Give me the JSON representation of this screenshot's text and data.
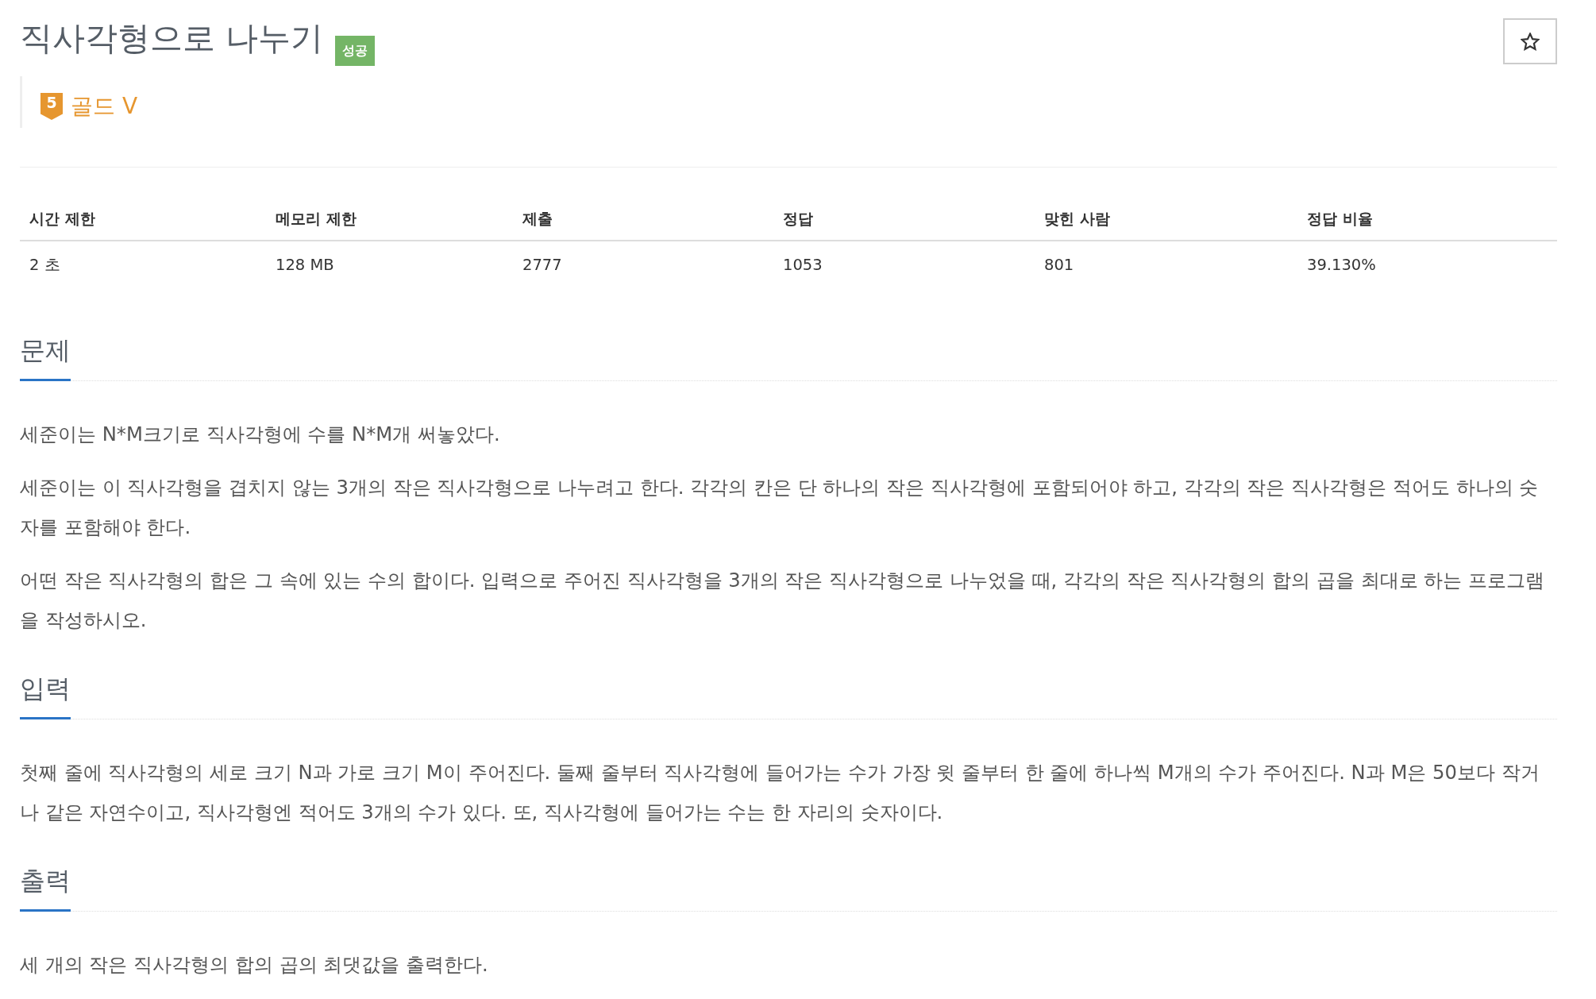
{
  "problem": {
    "title": "직사각형으로 나누기",
    "result": {
      "label": "성공",
      "kind": "success"
    },
    "tier": {
      "number": "5",
      "label": "골드 V"
    }
  },
  "favorite": {
    "starred": false
  },
  "table": {
    "columns": [
      "시간 제한",
      "메모리 제한",
      "제출",
      "정답",
      "맞힌 사람",
      "정답 비율"
    ],
    "rows": [
      [
        "2 초",
        "128 MB",
        "2777",
        "1053",
        "801",
        "39.130%"
      ]
    ]
  },
  "sections": [
    {
      "heading": "문제",
      "paragraphs": [
        "세준이는 N*M크기로 직사각형에 수를 N*M개 써놓았다.",
        "세준이는 이 직사각형을 겹치지 않는 3개의 작은 직사각형으로 나누려고 한다. 각각의 칸은 단 하나의 작은 직사각형에 포함되어야 하고, 각각의 작은 직사각형은 적어도 하나의 숫자를 포함해야 한다.",
        "어떤 작은 직사각형의 합은 그 속에 있는 수의 합이다. 입력으로 주어진 직사각형을 3개의 작은 직사각형으로 나누었을 때, 각각의 작은 직사각형의 합의 곱을 최대로 하는 프로그램을 작성하시오."
      ]
    },
    {
      "heading": "입력",
      "paragraphs": [
        "첫째 줄에 직사각형의 세로 크기 N과 가로 크기 M이 주어진다. 둘째 줄부터 직사각형에 들어가는 수가 가장 윗 줄부터 한 줄에 하나씩 M개의 수가 주어진다. N과 M은 50보다 작거나 같은 자연수이고, 직사각형엔 적어도 3개의 수가 있다. 또, 직사각형에 들어가는 수는 한 자리의 숫자이다."
      ]
    },
    {
      "heading": "출력",
      "paragraphs": [
        "세 개의 작은 직사각형의 합의 곱의 최댓값을 출력한다."
      ]
    }
  ]
}
